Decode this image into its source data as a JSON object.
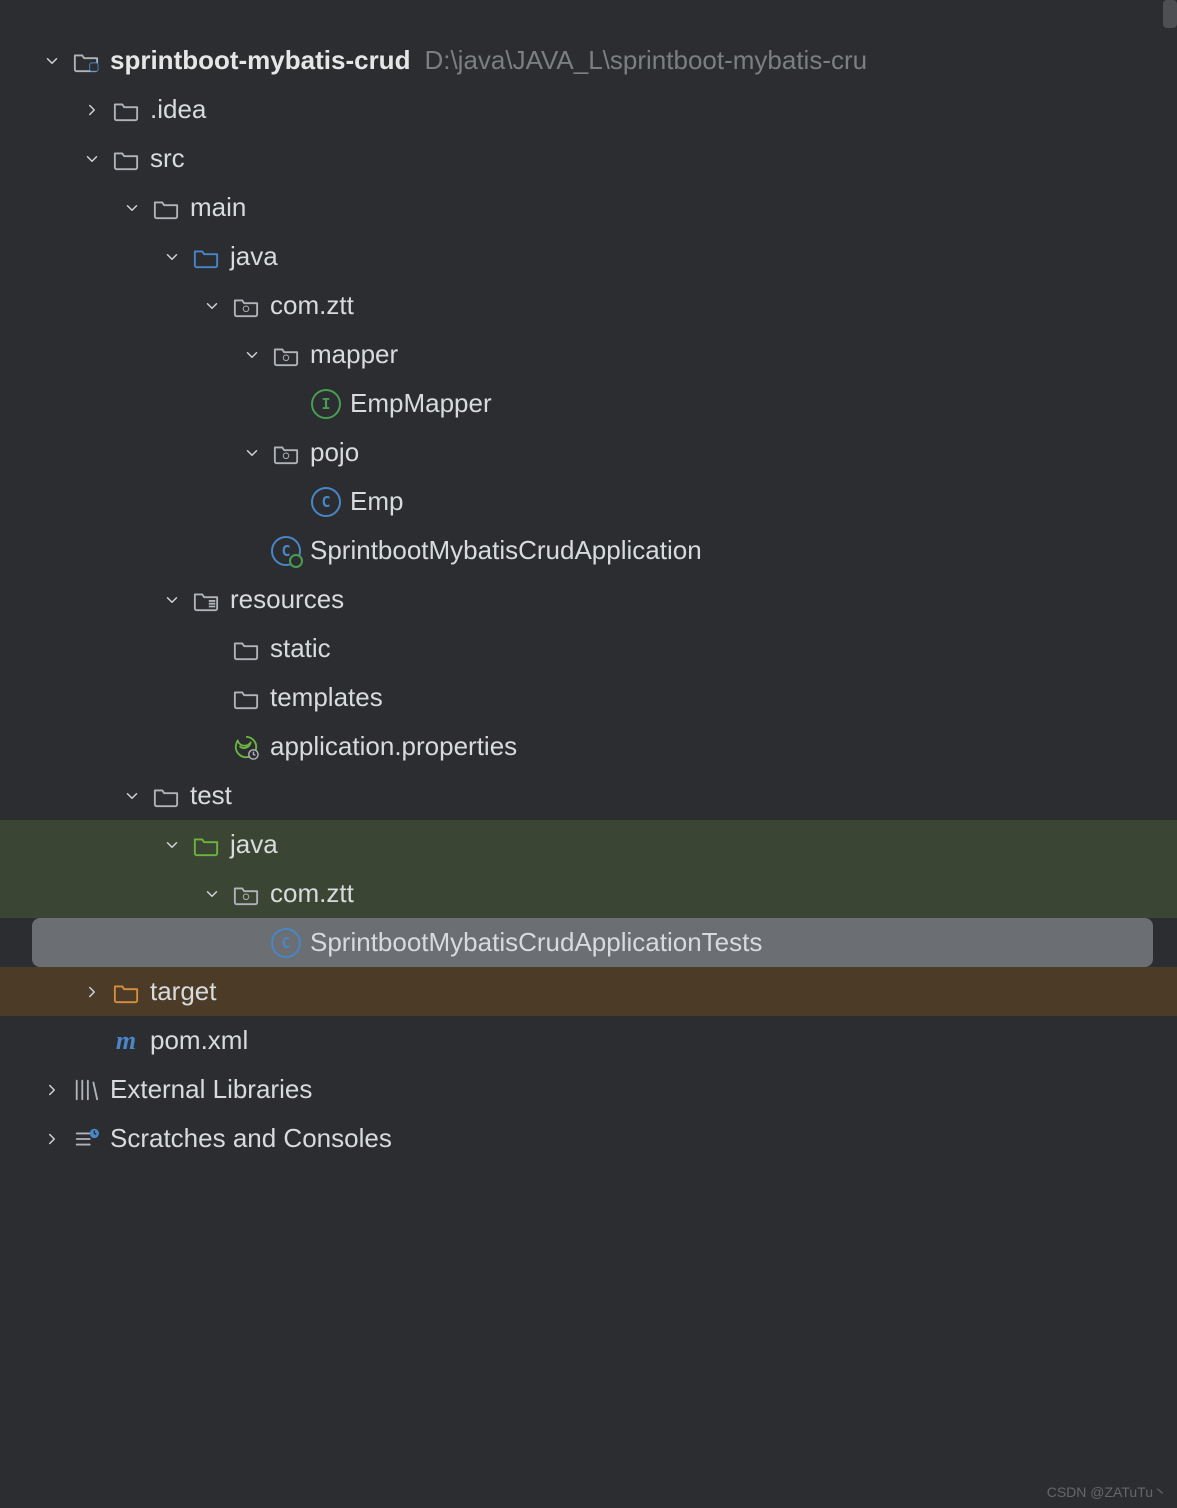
{
  "project": {
    "name": "sprintboot-mybatis-crud",
    "path": "D:\\java\\JAVA_L\\sprintboot-mybatis-cru"
  },
  "tree": {
    "idea": ".idea",
    "src": "src",
    "main": "main",
    "java": "java",
    "comztt": "com.ztt",
    "mapper": "mapper",
    "empMapper": "EmpMapper",
    "pojo": "pojo",
    "emp": "Emp",
    "app": "SprintbootMybatisCrudApplication",
    "resources": "resources",
    "static": "static",
    "templates": "templates",
    "appProps": "application.properties",
    "test": "test",
    "testJava": "java",
    "testComztt": "com.ztt",
    "appTests": "SprintbootMybatisCrudApplicationTests",
    "target": "target",
    "pom": "pom.xml",
    "extLibs": "External Libraries",
    "scratches": "Scratches and Consoles"
  },
  "watermark": "CSDN @ZATuTu丶"
}
